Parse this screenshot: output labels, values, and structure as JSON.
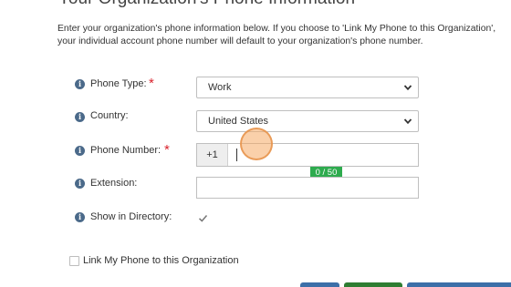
{
  "page": {
    "title": "Your Organization's Phone Information",
    "intro_line1": "Enter your organization's phone information below. If you choose to 'Link My Phone to this Organization',",
    "intro_line2": "your individual account phone number will default to your organization's phone number."
  },
  "form": {
    "phone_type": {
      "label": "Phone Type:",
      "required_mark": "*",
      "value": "Work"
    },
    "country": {
      "label": "Country:",
      "value": "United States"
    },
    "phone_number": {
      "label": "Phone Number:",
      "required_mark": "*",
      "prefix": "+1",
      "value": "",
      "counter": "0 / 50"
    },
    "extension": {
      "label": "Extension:",
      "value": ""
    },
    "show_in_directory": {
      "label": "Show in Directory:",
      "checked": true
    },
    "link_phone": {
      "label": "Link My Phone to this Organization",
      "checked": false
    }
  },
  "colors": {
    "required": "#d9232d",
    "info_icon": "#4b6a8a",
    "counter_badge": "#2eab4e",
    "button_blue": "#3c6fa8",
    "button_green": "#2e7d32"
  },
  "icons": {
    "info": "info-icon",
    "dropdown": "chevron-down-icon",
    "check": "check-icon"
  }
}
